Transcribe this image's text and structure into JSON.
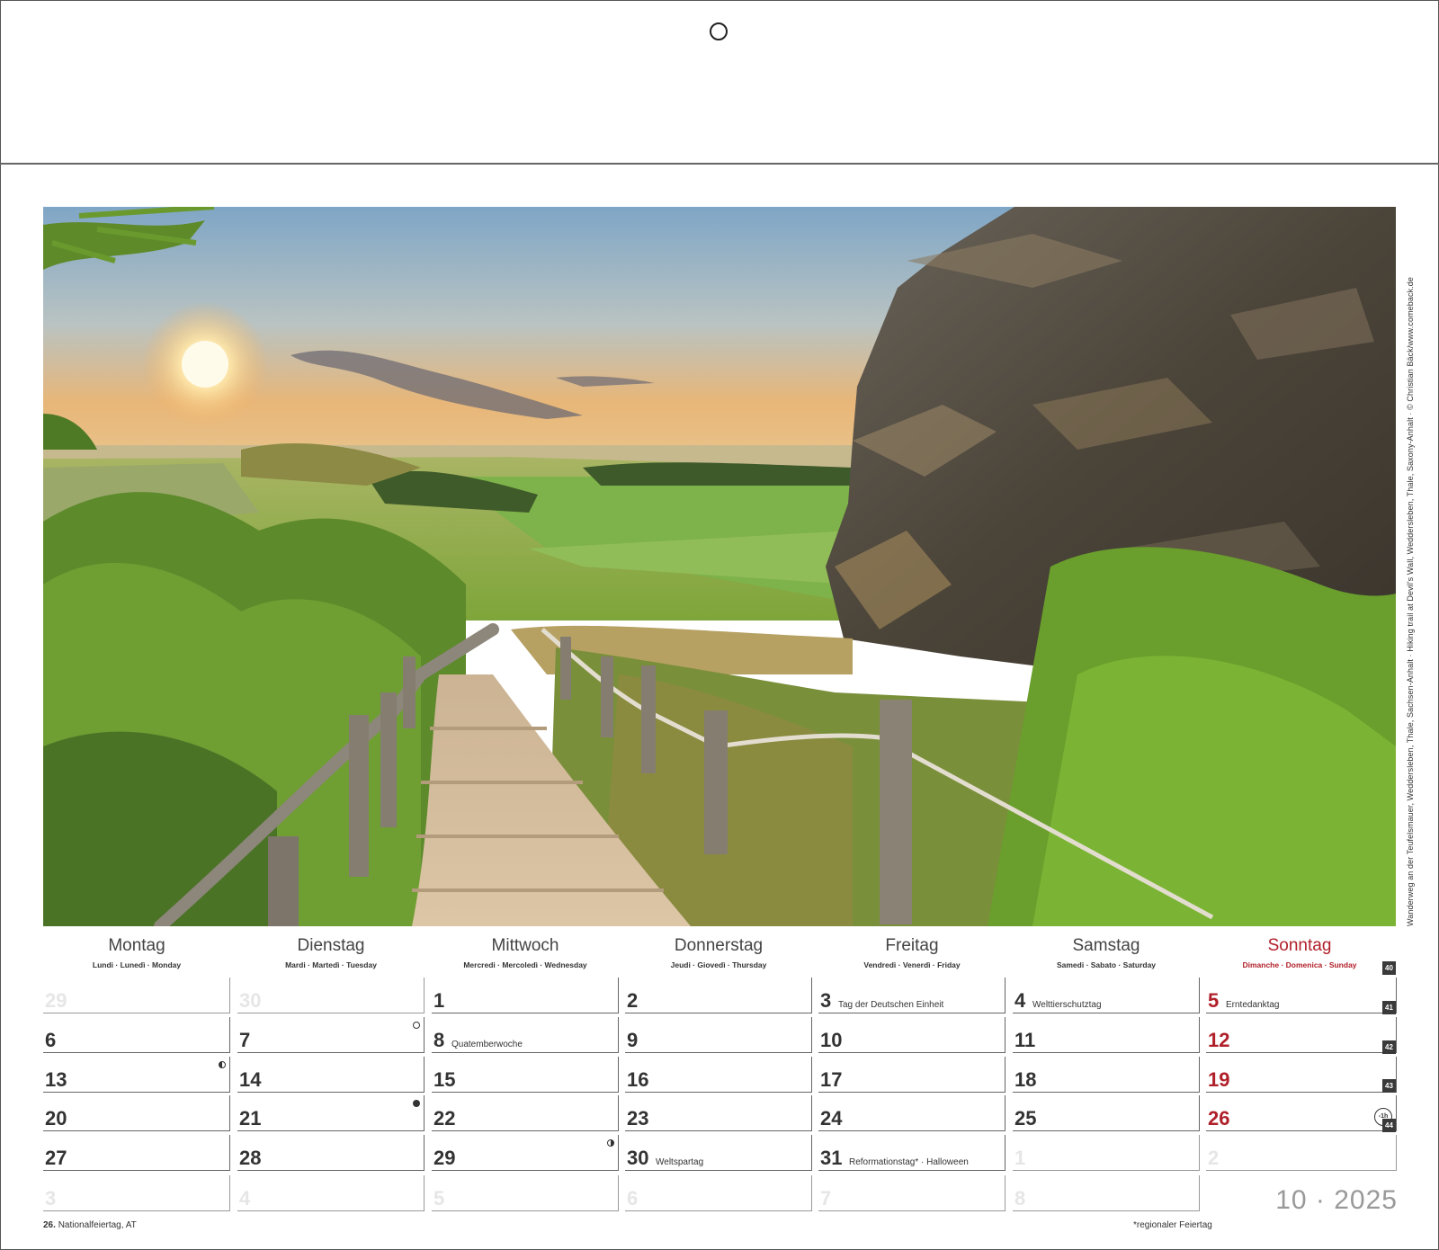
{
  "caption": "Wanderweg an der Teufelsmauer, Weddersleben, Thale, Sachsen-Anhalt · Hiking trail at Devil's Wall, Weddersleben, Thale, Saxony-Anhalt · © Christian Bäck/www.comeback.de",
  "weekdays": [
    {
      "name": "Montag",
      "sub": "Lundi · Lunedì · Monday"
    },
    {
      "name": "Dienstag",
      "sub": "Mardi · Martedì · Tuesday"
    },
    {
      "name": "Mittwoch",
      "sub": "Mercredi · Mercoledì · Wednesday"
    },
    {
      "name": "Donnerstag",
      "sub": "Jeudi · Giovedì · Thursday"
    },
    {
      "name": "Freitag",
      "sub": "Vendredi · Venerdì · Friday"
    },
    {
      "name": "Samstag",
      "sub": "Samedi · Sabato · Saturday"
    },
    {
      "name": "Sonntag",
      "sub": "Dimanche · Domenica · Sunday"
    }
  ],
  "weeks": [
    {
      "kw": "40",
      "days": [
        {
          "n": "29",
          "ghost": true
        },
        {
          "n": "30",
          "ghost": true
        },
        {
          "n": "1"
        },
        {
          "n": "2"
        },
        {
          "n": "3",
          "note": "Tag der Deutschen Einheit"
        },
        {
          "n": "4",
          "note": "Welttierschutztag"
        },
        {
          "n": "5",
          "note": "Erntedanktag"
        }
      ]
    },
    {
      "kw": "41",
      "days": [
        {
          "n": "6"
        },
        {
          "n": "7",
          "moon": "full"
        },
        {
          "n": "8",
          "note": "Quatemberwoche"
        },
        {
          "n": "9"
        },
        {
          "n": "10"
        },
        {
          "n": "11"
        },
        {
          "n": "12"
        }
      ]
    },
    {
      "kw": "42",
      "days": [
        {
          "n": "13",
          "moon": "last"
        },
        {
          "n": "14"
        },
        {
          "n": "15"
        },
        {
          "n": "16"
        },
        {
          "n": "17"
        },
        {
          "n": "18"
        },
        {
          "n": "19"
        }
      ]
    },
    {
      "kw": "43",
      "days": [
        {
          "n": "20"
        },
        {
          "n": "21",
          "moon": "new"
        },
        {
          "n": "22"
        },
        {
          "n": "23"
        },
        {
          "n": "24"
        },
        {
          "n": "25"
        },
        {
          "n": "26",
          "clock": "-1h"
        }
      ]
    },
    {
      "kw": "44",
      "days": [
        {
          "n": "27"
        },
        {
          "n": "28"
        },
        {
          "n": "29",
          "moon": "first"
        },
        {
          "n": "30",
          "note": "Weltspartag"
        },
        {
          "n": "31",
          "note": "Reformationstag* · Halloween"
        },
        {
          "n": "1",
          "ghost": true
        },
        {
          "n": "2",
          "ghost": true
        }
      ]
    },
    {
      "kw": "",
      "days": [
        {
          "n": "3",
          "ghost": true
        },
        {
          "n": "4",
          "ghost": true
        },
        {
          "n": "5",
          "ghost": true
        },
        {
          "n": "6",
          "ghost": true
        },
        {
          "n": "7",
          "ghost": true
        },
        {
          "n": "8",
          "ghost": true
        }
      ]
    }
  ],
  "month_year": "10 · 2025",
  "footnote_left_bold": "26.",
  "footnote_left": "Nationalfeiertag, AT",
  "footnote_right": "*regionaler Feiertag",
  "colors": {
    "sunday": "#b0202a",
    "ghost": "#e6e6e6",
    "badge": "#3a3a3a"
  }
}
